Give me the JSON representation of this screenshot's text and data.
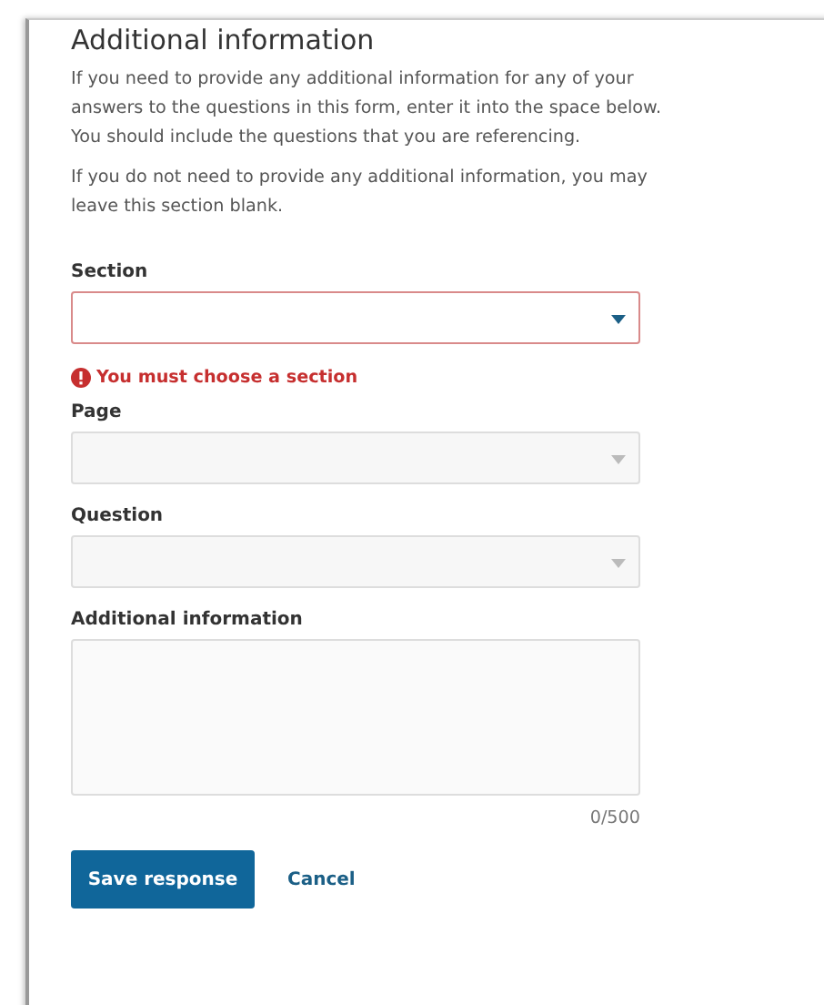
{
  "heading": "Additional information",
  "paragraphs": [
    "If you need to provide any additional information for any of your answers to the questions in this form, enter it into the space below. You should include the questions that you are referencing.",
    "If you do not need to provide any additional information, you may leave this section blank."
  ],
  "selects": [
    {
      "label": "Section",
      "disabled": false,
      "error": "You must choose a section"
    },
    {
      "label": "Page",
      "disabled": true
    },
    {
      "label": "Question",
      "disabled": true
    }
  ],
  "textarea": {
    "label": "Additional information",
    "counter": "0/500"
  },
  "buttons": {
    "primary": "Save response",
    "secondary": "Cancel"
  }
}
